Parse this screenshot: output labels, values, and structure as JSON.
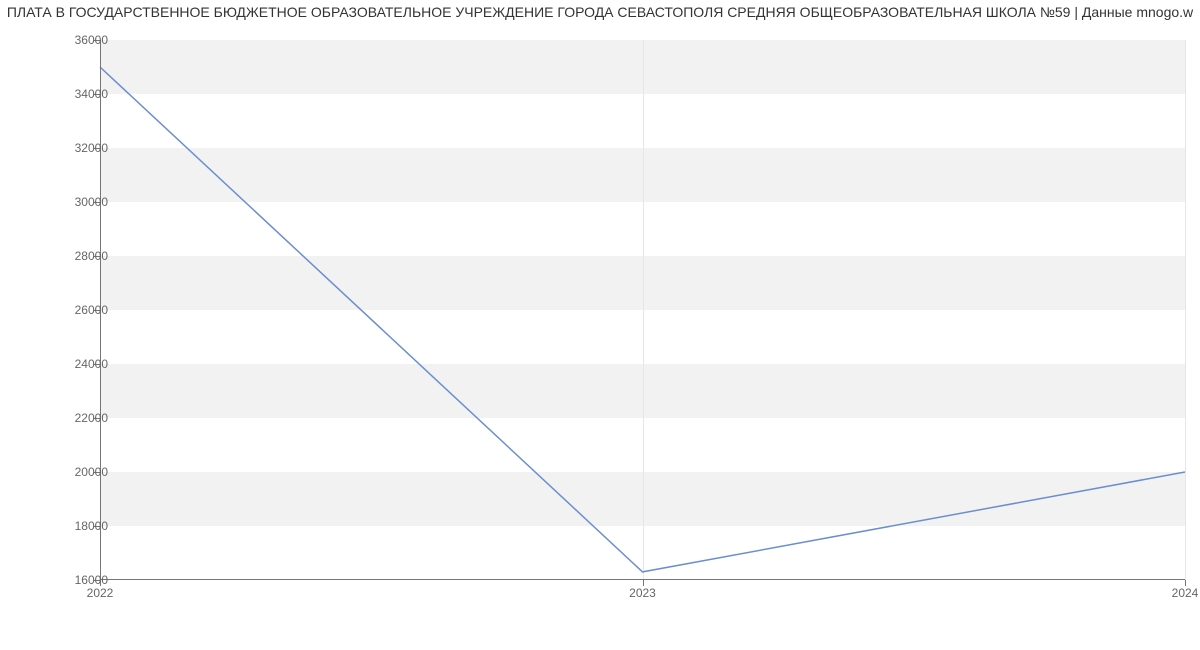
{
  "chart_data": {
    "type": "line",
    "title": "ПЛАТА В ГОСУДАРСТВЕННОЕ БЮДЖЕТНОЕ ОБРАЗОВАТЕЛЬНОЕ УЧРЕЖДЕНИЕ ГОРОДА СЕВАСТОПОЛЯ СРЕДНЯЯ ОБЩЕОБРАЗОВАТЕЛЬНАЯ ШКОЛА №59 | Данные mnogo.w",
    "x": [
      2022,
      2023,
      2024
    ],
    "values": [
      35000,
      16300,
      20000
    ],
    "xlabel": "",
    "ylabel": "",
    "xlim": [
      2022,
      2024
    ],
    "ylim": [
      16000,
      36000
    ],
    "x_ticks": [
      2022,
      2023,
      2024
    ],
    "y_ticks": [
      16000,
      18000,
      20000,
      22000,
      24000,
      26000,
      28000,
      30000,
      32000,
      34000,
      36000
    ],
    "line_color": "#6b8ecf",
    "band_color": "#f2f2f2"
  }
}
